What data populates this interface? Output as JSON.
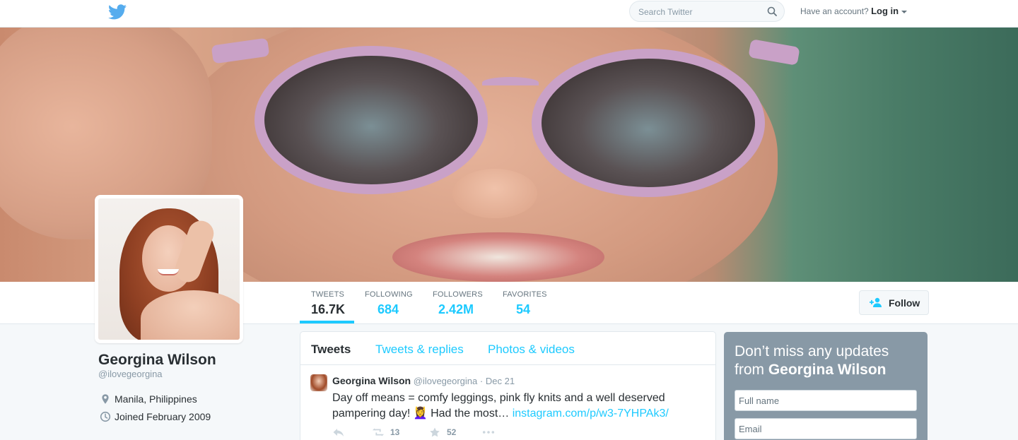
{
  "topbar": {
    "logo_icon": "twitter-bird-icon",
    "search_placeholder": "Search Twitter",
    "account_prompt": "Have an account?",
    "login_label": "Log in"
  },
  "profile": {
    "name": "Georgina Wilson",
    "handle": "@ilovegeorgina",
    "location": "Manila, Philippines",
    "joined": "Joined February 2009"
  },
  "stats": [
    {
      "label": "TWEETS",
      "value": "16.7K"
    },
    {
      "label": "FOLLOWING",
      "value": "684"
    },
    {
      "label": "FOLLOWERS",
      "value": "2.42M"
    },
    {
      "label": "FAVORITES",
      "value": "54"
    }
  ],
  "follow_label": "Follow",
  "timeline": {
    "tabs": [
      "Tweets",
      "Tweets & replies",
      "Photos & videos"
    ],
    "tweet": {
      "name": "Georgina Wilson",
      "handle": "@ilovegeorgina",
      "separator": "·",
      "date": "Dec 21",
      "text": "Day off means = comfy leggings, pink fly knits and a well deserved pampering day! 💆‍♀️ Had the most… ",
      "link": "instagram.com/p/w3-7YHPAk3/",
      "retweets": "13",
      "favorites": "52"
    }
  },
  "signup": {
    "heading_prefix": "Don’t miss any updates from",
    "heading_name": "Georgina Wilson",
    "fullname_placeholder": "Full name",
    "email_placeholder": "Email"
  },
  "colors": {
    "accent": "#1dcaff",
    "text": "#292f33",
    "muted": "#8899a6",
    "signup_bg": "#8899a6"
  }
}
